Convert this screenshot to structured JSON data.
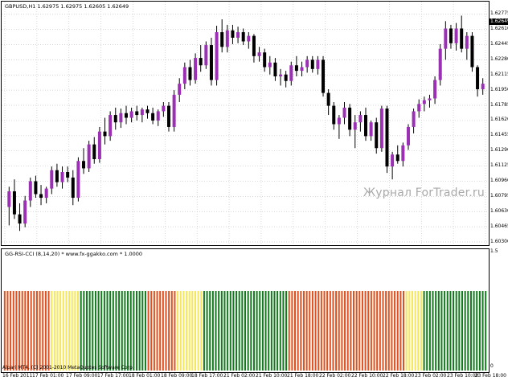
{
  "header": {
    "symbol_line": "GBPUSD,H1  1.62975 1.62975 1.62605 1.62649",
    "indicator_line": "GG-RSI-CCI (8,14,20) * www.fx-ggakko.com *  1.0000"
  },
  "watermark": "Журнал ForTrader.ru",
  "copyright": "Alpari MT4, (C) 2001-2010 MetaQuotes Software Corp.",
  "price_axis": {
    "ticks": [
      "1.62775",
      "1.62610",
      "1.62445",
      "1.62280",
      "1.62115",
      "1.61950",
      "1.61785",
      "1.61620",
      "1.61455",
      "1.61290",
      "1.61125",
      "1.60960",
      "1.60795",
      "1.60630",
      "1.60465",
      "1.60300"
    ],
    "current_price": "1.62649"
  },
  "indicator_axis": {
    "top": "1.5",
    "bottom": "0"
  },
  "time_axis": {
    "labels": [
      "16 Feb 2011",
      "17 Feb 01:00",
      "17 Feb 09:00",
      "17 Feb 17:00",
      "18 Feb 01:00",
      "18 Feb 09:00",
      "18 Feb 17:00",
      "21 Feb 02:00",
      "21 Feb 10:00",
      "21 Feb 18:00",
      "22 Feb 02:00",
      "22 Feb 10:00",
      "22 Feb 18:00",
      "23 Feb 02:00",
      "23 Feb 10:00",
      "23 Feb 18:00"
    ]
  },
  "colors": {
    "bull": "#9b30b5",
    "bear": "#000000",
    "grid": "#c8c8c8",
    "watermark": "#a9a9a9",
    "ind_red": "#e1501e",
    "ind_yellow": "#f5e65a",
    "ind_green": "#137a1e"
  },
  "chart_data": {
    "type": "candlestick",
    "symbol": "GBPUSD",
    "timeframe": "H1",
    "ylim": [
      1.603,
      1.6286
    ],
    "candles": [
      [
        1.6068,
        1.609,
        1.6048,
        1.6085
      ],
      [
        1.6085,
        1.6098,
        1.6055,
        1.606
      ],
      [
        1.606,
        1.6072,
        1.6042,
        1.605
      ],
      [
        1.605,
        1.608,
        1.6046,
        1.6075
      ],
      [
        1.6075,
        1.61,
        1.6068,
        1.6096
      ],
      [
        1.6096,
        1.6102,
        1.6078,
        1.6082
      ],
      [
        1.6082,
        1.6092,
        1.607,
        1.6078
      ],
      [
        1.6078,
        1.609,
        1.6072,
        1.6088
      ],
      [
        1.6088,
        1.6112,
        1.6082,
        1.6108
      ],
      [
        1.6108,
        1.6115,
        1.609,
        1.6095
      ],
      [
        1.6095,
        1.6112,
        1.6088,
        1.6106
      ],
      [
        1.6106,
        1.6112,
        1.6095,
        1.61
      ],
      [
        1.61,
        1.6108,
        1.607,
        1.6078
      ],
      [
        1.6078,
        1.6122,
        1.6074,
        1.6118
      ],
      [
        1.6118,
        1.6132,
        1.6104,
        1.611
      ],
      [
        1.611,
        1.614,
        1.6106,
        1.6136
      ],
      [
        1.6136,
        1.6144,
        1.6115,
        1.612
      ],
      [
        1.612,
        1.6155,
        1.6116,
        1.615
      ],
      [
        1.615,
        1.6165,
        1.6136,
        1.6145
      ],
      [
        1.6145,
        1.6172,
        1.614,
        1.6168
      ],
      [
        1.6168,
        1.6176,
        1.6152,
        1.616
      ],
      [
        1.616,
        1.6175,
        1.6154,
        1.617
      ],
      [
        1.617,
        1.6178,
        1.6158,
        1.6165
      ],
      [
        1.6165,
        1.6176,
        1.616,
        1.6172
      ],
      [
        1.6172,
        1.6178,
        1.6162,
        1.6168
      ],
      [
        1.6168,
        1.6176,
        1.616,
        1.6174
      ],
      [
        1.6174,
        1.6178,
        1.6164,
        1.617
      ],
      [
        1.617,
        1.6176,
        1.6158,
        1.6162
      ],
      [
        1.6162,
        1.6174,
        1.6156,
        1.6172
      ],
      [
        1.6172,
        1.6182,
        1.6166,
        1.6178
      ],
      [
        1.6178,
        1.6182,
        1.615,
        1.6155
      ],
      [
        1.6155,
        1.6195,
        1.615,
        1.619
      ],
      [
        1.619,
        1.6208,
        1.6182,
        1.6202
      ],
      [
        1.6202,
        1.6225,
        1.6196,
        1.622
      ],
      [
        1.622,
        1.6228,
        1.62,
        1.6206
      ],
      [
        1.6206,
        1.6235,
        1.6202,
        1.623
      ],
      [
        1.623,
        1.6244,
        1.6215,
        1.6222
      ],
      [
        1.6222,
        1.6248,
        1.6218,
        1.6244
      ],
      [
        1.6244,
        1.6252,
        1.62,
        1.6206
      ],
      [
        1.6206,
        1.6265,
        1.62,
        1.6258
      ],
      [
        1.6258,
        1.6272,
        1.6236,
        1.6242
      ],
      [
        1.6242,
        1.6266,
        1.6236,
        1.626
      ],
      [
        1.626,
        1.6266,
        1.6245,
        1.6252
      ],
      [
        1.6252,
        1.6264,
        1.6246,
        1.6258
      ],
      [
        1.6258,
        1.6262,
        1.6244,
        1.6248
      ],
      [
        1.6248,
        1.6258,
        1.624,
        1.6254
      ],
      [
        1.6254,
        1.6256,
        1.6225,
        1.6232
      ],
      [
        1.6232,
        1.6242,
        1.6226,
        1.6236
      ],
      [
        1.6236,
        1.624,
        1.6215,
        1.622
      ],
      [
        1.622,
        1.6232,
        1.6212,
        1.6225
      ],
      [
        1.6225,
        1.623,
        1.6205,
        1.621
      ],
      [
        1.621,
        1.6218,
        1.62,
        1.6212
      ],
      [
        1.6212,
        1.6216,
        1.6198,
        1.6205
      ],
      [
        1.6205,
        1.6226,
        1.62,
        1.6222
      ],
      [
        1.6222,
        1.6232,
        1.621,
        1.6216
      ],
      [
        1.6216,
        1.6226,
        1.621,
        1.622
      ],
      [
        1.622,
        1.6232,
        1.6214,
        1.6228
      ],
      [
        1.6228,
        1.6232,
        1.6214,
        1.6218
      ],
      [
        1.6218,
        1.6232,
        1.6212,
        1.6228
      ],
      [
        1.6228,
        1.6232,
        1.6188,
        1.6192
      ],
      [
        1.6192,
        1.6196,
        1.6168,
        1.6178
      ],
      [
        1.6178,
        1.6182,
        1.6152,
        1.6158
      ],
      [
        1.6158,
        1.6168,
        1.6142,
        1.6165
      ],
      [
        1.6165,
        1.6182,
        1.6158,
        1.6176
      ],
      [
        1.6176,
        1.618,
        1.6145,
        1.6152
      ],
      [
        1.6152,
        1.6168,
        1.6132,
        1.616
      ],
      [
        1.616,
        1.6172,
        1.615,
        1.6168
      ],
      [
        1.6168,
        1.6176,
        1.614,
        1.6145
      ],
      [
        1.6145,
        1.6162,
        1.614,
        1.616
      ],
      [
        1.616,
        1.6165,
        1.6126,
        1.6132
      ],
      [
        1.6132,
        1.6178,
        1.6128,
        1.6175
      ],
      [
        1.6175,
        1.6178,
        1.6105,
        1.6112
      ],
      [
        1.6112,
        1.6128,
        1.6098,
        1.6125
      ],
      [
        1.6125,
        1.6135,
        1.6115,
        1.6118
      ],
      [
        1.6118,
        1.6138,
        1.6112,
        1.6135
      ],
      [
        1.6135,
        1.6158,
        1.613,
        1.6155
      ],
      [
        1.6155,
        1.6175,
        1.6148,
        1.6172
      ],
      [
        1.6172,
        1.6185,
        1.6165,
        1.618
      ],
      [
        1.618,
        1.6188,
        1.6172,
        1.6184
      ],
      [
        1.6184,
        1.619,
        1.6176,
        1.6186
      ],
      [
        1.6186,
        1.621,
        1.618,
        1.6206
      ],
      [
        1.6206,
        1.6245,
        1.62,
        1.624
      ],
      [
        1.624,
        1.627,
        1.6228,
        1.6262
      ],
      [
        1.6262,
        1.6266,
        1.624,
        1.6246
      ],
      [
        1.6246,
        1.6268,
        1.6238,
        1.6262
      ],
      [
        1.6262,
        1.6276,
        1.6236,
        1.624
      ],
      [
        1.624,
        1.6258,
        1.6228,
        1.6254
      ],
      [
        1.6254,
        1.6258,
        1.6215,
        1.622
      ],
      [
        1.622,
        1.6222,
        1.6188,
        1.6196
      ],
      [
        1.6196,
        1.6208,
        1.619,
        1.6202
      ]
    ]
  },
  "indicator_data": {
    "type": "histogram",
    "value": 1.0,
    "colors_seq": "RRRRRRRRRRRRRRRRYYYYYYYYYYGGGGGGGGGGGGGGGGGGGGGGGRRRRRRRRRRYYYYYYYYYGGGGGGGGGGGGGGGGGGGGGGGGGGGGGRRRRRRRRRRRRRRRRRRRRRRRRRRRRRRRRRRRRRRRRYYYYYYGGGGGGGGGGGGGGGGGGGGGG"
  }
}
